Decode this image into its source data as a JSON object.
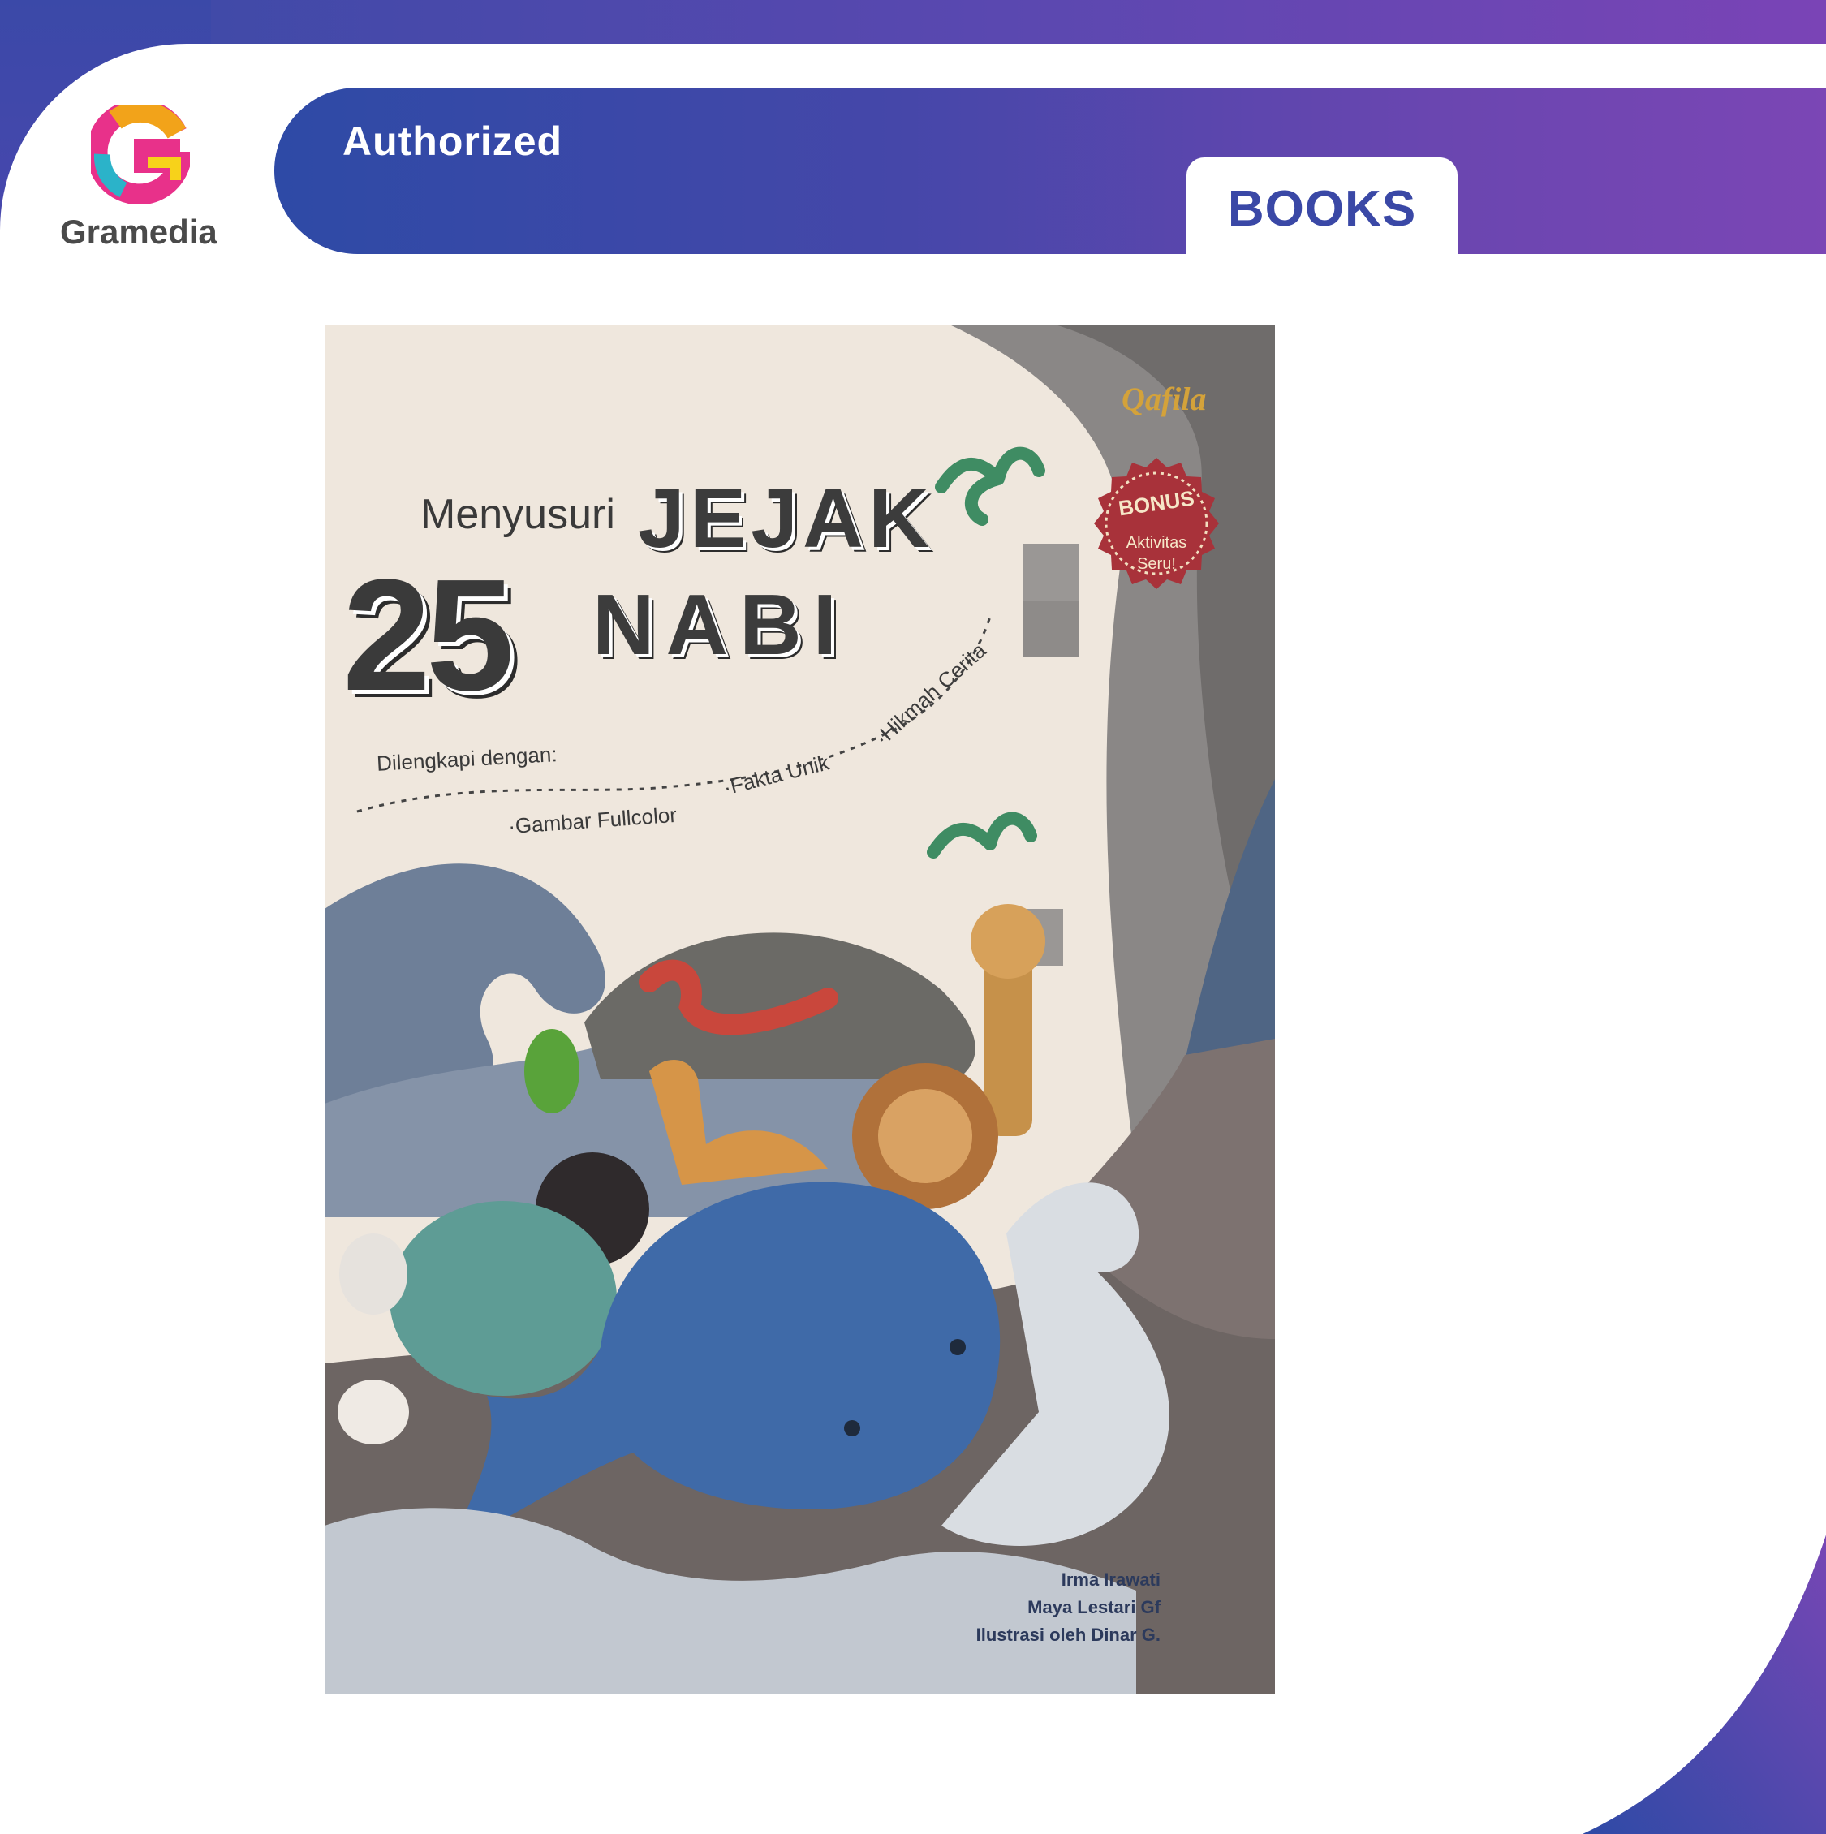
{
  "frame": {
    "authorized_label": "Authorized",
    "books_label": "BOOKS",
    "brand_name": "Gramedia",
    "colors": {
      "frame_blue": "#3b49a8",
      "frame_purple": "#7b46b5",
      "books_text": "#3a48a6"
    }
  },
  "cover": {
    "publisher": "Qafila",
    "bonus": {
      "badge": "BONUS",
      "line1": "Aktivitas",
      "line2": "Seru!"
    },
    "title": {
      "prefix": "Menyusuri",
      "word1": "JEJAK",
      "number": "25",
      "word2": "NABI"
    },
    "features": {
      "intro": "Dilengkapi dengan:",
      "item1": "·Gambar Fullcolor",
      "item2": "·Fakta Unik",
      "item3": "·Hikmah Cerita"
    },
    "authors": {
      "author1": "Irma Irawati",
      "author2": "Maya Lestari Gf",
      "illustrator": "Ilustrasi oleh Dinar G."
    }
  }
}
